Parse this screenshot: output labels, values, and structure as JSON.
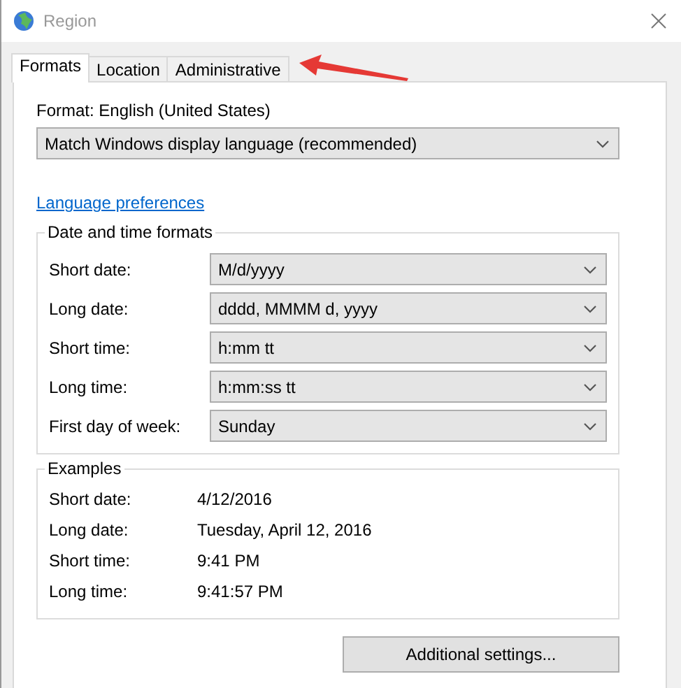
{
  "window": {
    "title": "Region"
  },
  "tabs": [
    {
      "label": "Formats",
      "selected": true
    },
    {
      "label": "Location",
      "selected": false
    },
    {
      "label": "Administrative",
      "selected": false
    }
  ],
  "format": {
    "label": "Format: English (United States)",
    "value": "Match Windows display language (recommended)"
  },
  "language_link": "Language preferences",
  "date_time_formats": {
    "title": "Date and time formats",
    "rows": [
      {
        "label": "Short date:",
        "value": "M/d/yyyy"
      },
      {
        "label": "Long date:",
        "value": "dddd, MMMM d, yyyy"
      },
      {
        "label": "Short time:",
        "value": "h:mm tt"
      },
      {
        "label": "Long time:",
        "value": "h:mm:ss tt"
      },
      {
        "label": "First day of week:",
        "value": "Sunday"
      }
    ]
  },
  "examples": {
    "title": "Examples",
    "rows": [
      {
        "label": "Short date:",
        "value": "4/12/2016"
      },
      {
        "label": "Long date:",
        "value": "Tuesday, April 12, 2016"
      },
      {
        "label": "Short time:",
        "value": "9:41 PM"
      },
      {
        "label": "Long time:",
        "value": "9:41:57 PM"
      }
    ]
  },
  "buttons": [
    "Additional settings..."
  ]
}
